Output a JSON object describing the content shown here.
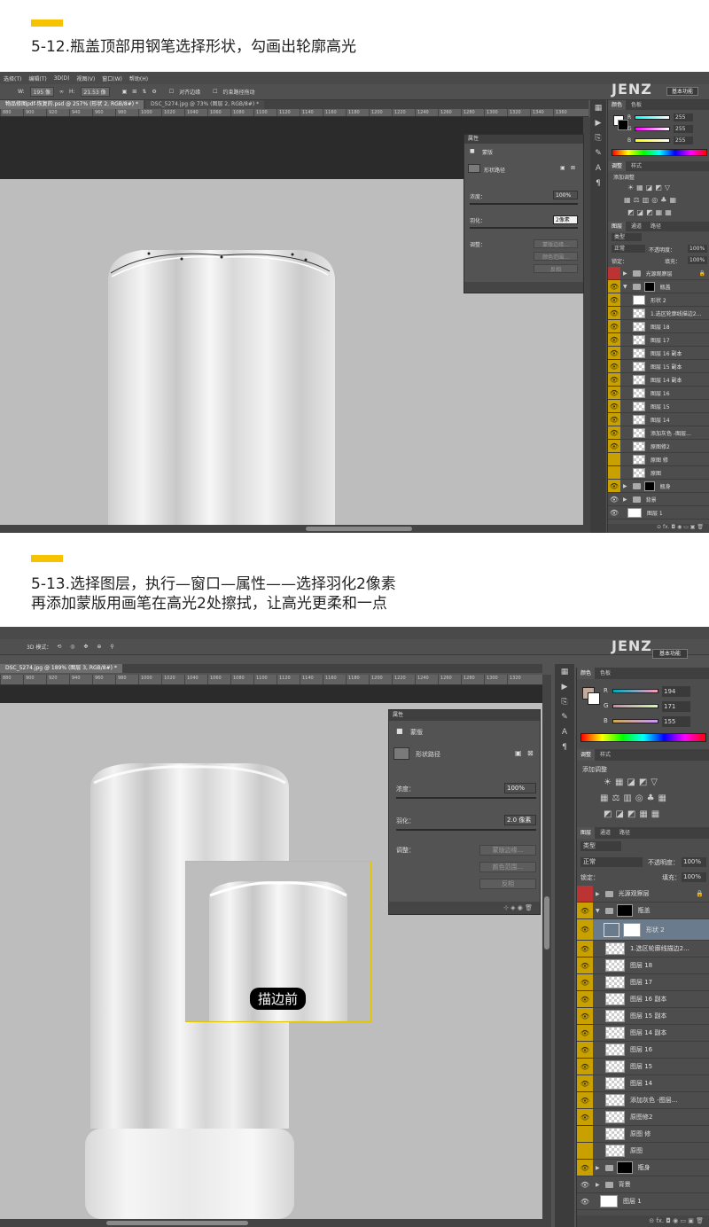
{
  "step1": {
    "title": "5-12.瓶盖顶部用钢笔选择形状，勾画出轮廓高光",
    "menu": [
      "选择(T)",
      "编辑(T)",
      "3D(D)",
      "视图(V)",
      "窗口(W)",
      "帮助(H)"
    ],
    "options": {
      "w_label": "W:",
      "w_value": "195 像",
      "h_label": "H:",
      "h_value": "21.53 像",
      "align_edges": "对齐边缘",
      "constrain_path": "约束路径拖动"
    },
    "tabs": [
      "物品修图pdf-恢复的.psd @ 257% (形状 2, RGB/8#) *",
      "DSC_5274.jpg @ 73% (图层 2, RGB/8#) *"
    ],
    "ruler": [
      "880",
      "900",
      "920",
      "940",
      "960",
      "980",
      "1000",
      "1020",
      "1040",
      "1060",
      "1080",
      "1100",
      "1120",
      "1140",
      "1160",
      "1180",
      "1200",
      "1220",
      "1240",
      "1260",
      "1280",
      "1300",
      "1320",
      "1340",
      "1360"
    ],
    "logo": "JENZ",
    "workspace": "基本功能",
    "color_panel": {
      "tabs": [
        "颜色",
        "色板"
      ],
      "r": "255",
      "g": "255",
      "b": "255",
      "r_label": "R",
      "g_label": "G",
      "b_label": "B"
    },
    "adjust_panel": {
      "tabs": [
        "调整",
        "样式"
      ],
      "label": "添加调整"
    },
    "properties": {
      "title": "属性",
      "mask_label": "蒙版",
      "path_label": "形状路径",
      "density_label": "浓度：",
      "density_value": "100%",
      "feather_label": "羽化：",
      "feather_value": "2像素",
      "adjust_label": "调整：",
      "btn1": "蒙版边缘...",
      "btn2": "颜色范围...",
      "btn3": "反相"
    },
    "layers_panel": {
      "tabs": [
        "图层",
        "通道",
        "路径"
      ],
      "kind": "类型",
      "blend": "正常",
      "opacity_label": "不透明度：",
      "opacity": "100%",
      "lock_label": "锁定：",
      "fill_label": "填充：",
      "fill": "100%"
    },
    "layers": [
      "光源观察层",
      "瓶盖",
      "形状 2",
      "1.选区轮廓线描边2...",
      "图层 18",
      "图层 17",
      "图层 16 副本",
      "图层 15 副本",
      "图层 14 副本",
      "图层 16",
      "图层 15",
      "图层 14",
      "添加灰色 -图层...",
      "原图修2",
      "原图 修",
      "原图",
      "瓶身",
      "背景",
      "图层 1"
    ]
  },
  "step2": {
    "title_line1": "5-13.选择图层，执行—窗口—属性——选择羽化2像素",
    "title_line2": "再添加蒙版用画笔在高光2处擦拭，让高光更柔和一点",
    "options_label": "3D 模式：",
    "tab": "DSC_5274.jpg @ 189% (图层 3, RGB/8#) *",
    "ruler": [
      "880",
      "900",
      "920",
      "940",
      "960",
      "980",
      "1000",
      "1020",
      "1040",
      "1060",
      "1080",
      "1100",
      "1120",
      "1140",
      "1160",
      "1180",
      "1200",
      "1220",
      "1240",
      "1260",
      "1280",
      "1300",
      "1320"
    ],
    "logo": "JENZ",
    "workspace": "基本功能",
    "color_panel": {
      "tabs": [
        "颜色",
        "色板"
      ],
      "r": "194",
      "g": "171",
      "b": "155",
      "r_label": "R",
      "g_label": "G",
      "b_label": "B"
    },
    "adjust_panel": {
      "tabs": [
        "调整",
        "样式"
      ],
      "label": "添加调整"
    },
    "properties": {
      "title": "属性",
      "mask_label": "蒙版",
      "path_label": "形状路径",
      "density_label": "浓度：",
      "density_value": "100%",
      "feather_label": "羽化：",
      "feather_value": "2.0 像素",
      "adjust_label": "调整：",
      "btn1": "蒙版边缘...",
      "btn2": "颜色范围...",
      "btn3": "反相"
    },
    "layers_panel": {
      "tabs": [
        "图层",
        "通道",
        "路径"
      ],
      "kind": "类型",
      "blend": "正常",
      "opacity_label": "不透明度：",
      "opacity": "100%",
      "lock_label": "锁定：",
      "fill_label": "填充：",
      "fill": "100%"
    },
    "layers": [
      "光源观察层",
      "瓶盖",
      "形状 2",
      "1.选区轮廓线描边2...",
      "图层 18",
      "图层 17",
      "图层 16 副本",
      "图层 15 副本",
      "图层 14 副本",
      "图层 16",
      "图层 15",
      "图层 14",
      "添加灰色 -图层...",
      "原图修2",
      "原图 修",
      "原图",
      "瓶身",
      "背景",
      "图层 1"
    ],
    "before_label": "描边前"
  }
}
